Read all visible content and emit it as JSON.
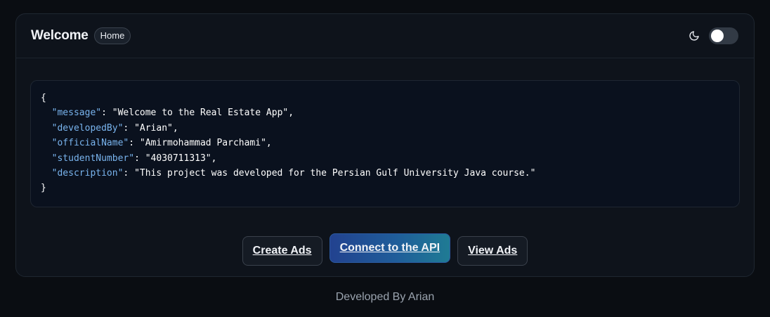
{
  "header": {
    "title": "Welcome",
    "badge": "Home",
    "theme_icon": "moon-icon",
    "theme_toggle_on": false
  },
  "code": {
    "open": "{",
    "close": "}",
    "entries": [
      {
        "key": "\"message\"",
        "value": "\"Welcome to the Real Estate App\","
      },
      {
        "key": "\"developedBy\"",
        "value": "\"Arian\","
      },
      {
        "key": "\"officialName\"",
        "value": "\"Amirmohammad Parchami\","
      },
      {
        "key": "\"studentNumber\"",
        "value": "\"4030711313\","
      },
      {
        "key": "\"description\"",
        "value": "\"This project was developed for the Persian Gulf University Java course.\""
      }
    ]
  },
  "actions": {
    "create": "Create Ads",
    "connect": "Connect to the API",
    "view": "View Ads"
  },
  "footer": {
    "text": "Developed By Arian"
  },
  "colors": {
    "key": "#79b4ee",
    "primary_gradient_start": "#22428f",
    "primary_gradient_end": "#1f7b94"
  }
}
